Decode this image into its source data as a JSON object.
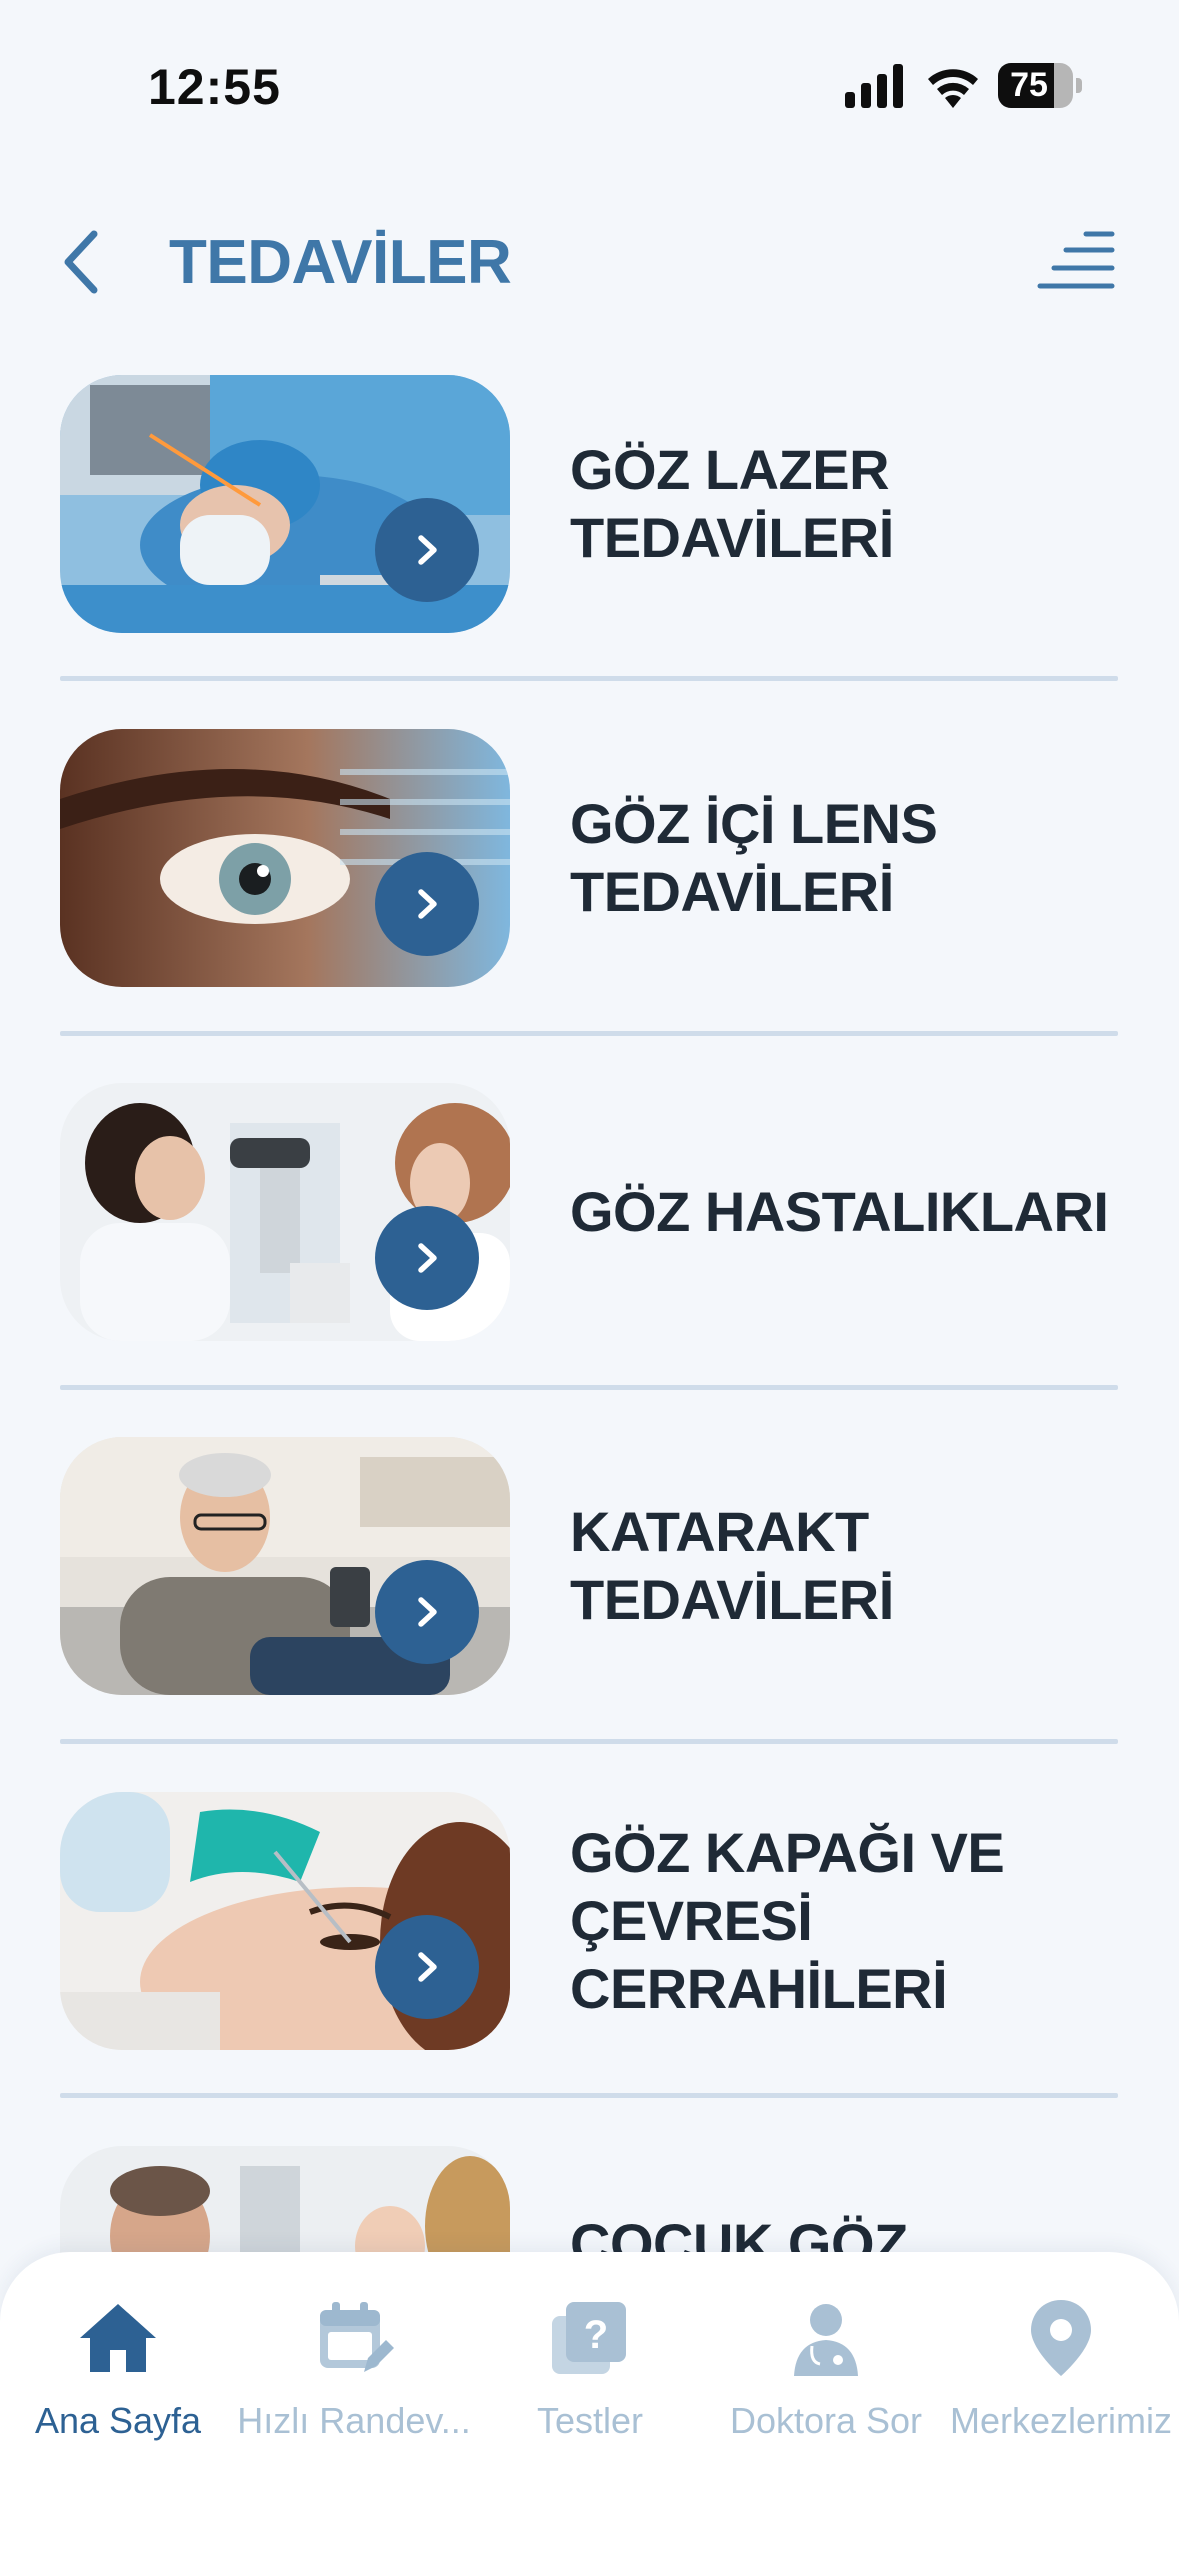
{
  "status_bar": {
    "time": "12:55",
    "battery_level": "75"
  },
  "header": {
    "title": "TEDAVİLER"
  },
  "treatments": [
    {
      "label": "GÖZ LAZER\nTEDAVİLERİ"
    },
    {
      "label": "GÖZ İÇİ LENS\nTEDAVİLERİ"
    },
    {
      "label": "GÖZ HASTALIKLARI"
    },
    {
      "label": "KATARAKT\nTEDAVİLERİ"
    },
    {
      "label": "GÖZ KAPAĞI VE\nÇEVRESİ\nCERRAHİLERİ"
    },
    {
      "label": "ÇOCUK GÖZ"
    }
  ],
  "tab_bar": {
    "items": [
      {
        "label": "Ana Sayfa",
        "icon": "home-icon"
      },
      {
        "label": "Hızlı Randev...",
        "icon": "calendar-edit-icon"
      },
      {
        "label": "Testler",
        "icon": "question-icon"
      },
      {
        "label": "Doktora Sor",
        "icon": "doctor-icon"
      },
      {
        "label": "Merkezlerimiz",
        "icon": "location-pin-icon"
      }
    ]
  },
  "colors": {
    "accent": "#2d6193",
    "title": "#3f77a8",
    "inactive": "#a9c0d4",
    "background": "#f4f7fb"
  }
}
